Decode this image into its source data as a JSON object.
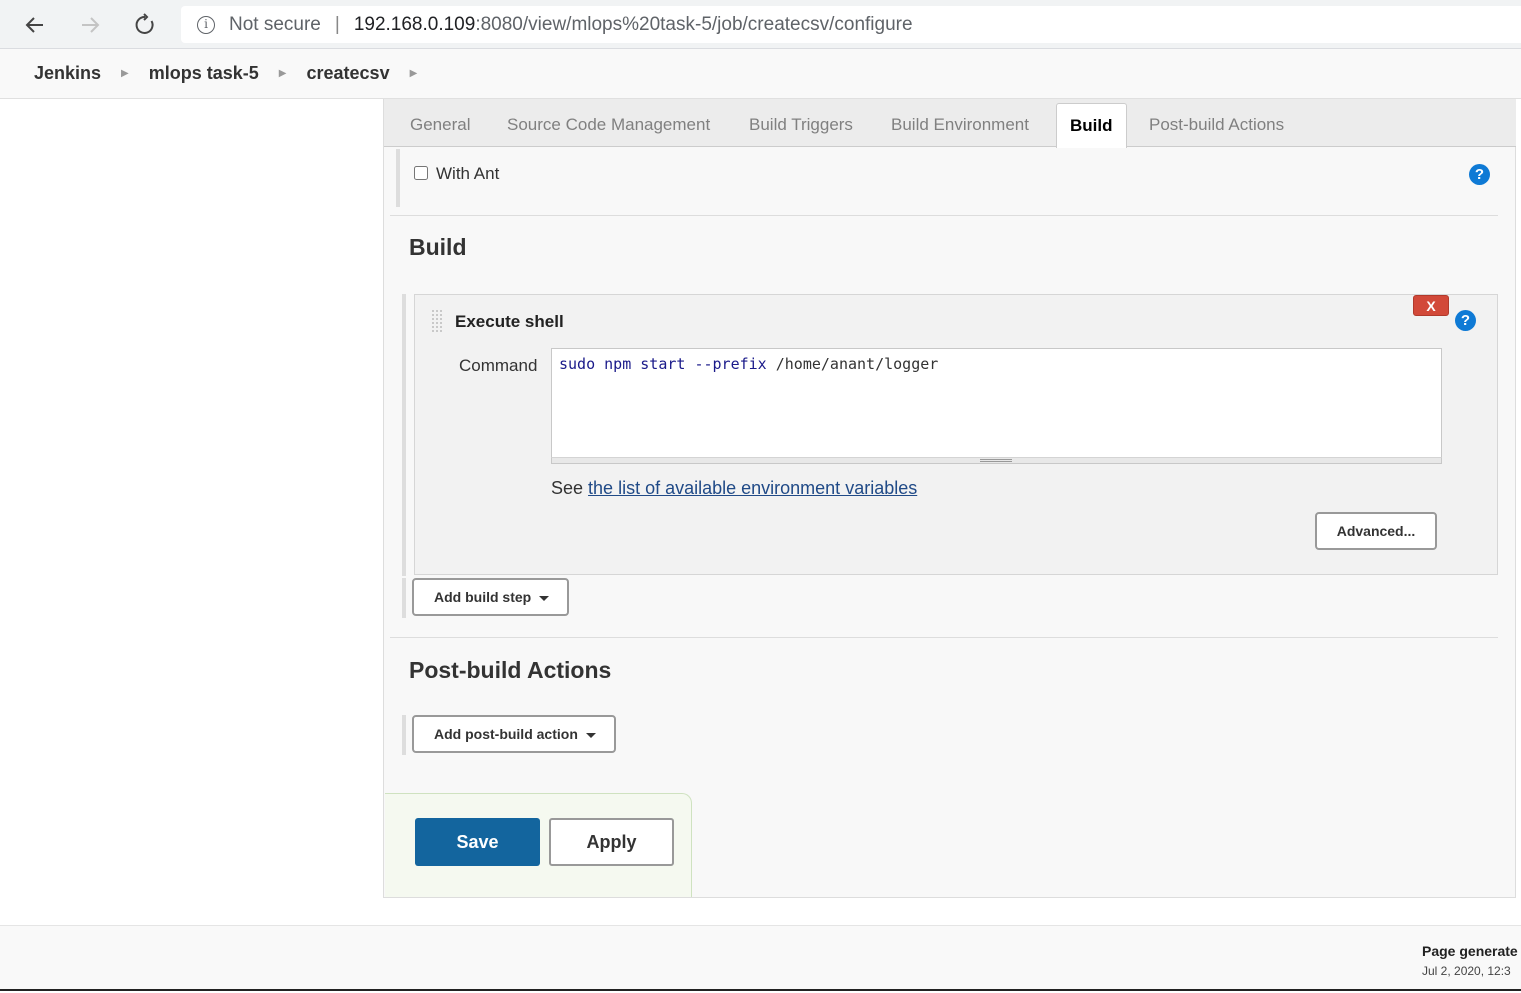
{
  "browser": {
    "security_label": "Not secure",
    "separator": "|",
    "url_host": "192.168.0.109",
    "url_rest": ":8080/view/mlops%20task-5/job/createcsv/configure"
  },
  "breadcrumbs": [
    "Jenkins",
    "mlops task-5",
    "createcsv"
  ],
  "tabs": [
    "General",
    "Source Code Management",
    "Build Triggers",
    "Build Environment",
    "Build",
    "Post-build Actions"
  ],
  "active_tab": "Build",
  "with_ant": {
    "label": "With Ant",
    "checked": false
  },
  "build_section": {
    "title": "Build",
    "step": {
      "title": "Execute shell",
      "delete_label": "X",
      "command_label": "Command",
      "command_keywords": "sudo npm start --prefix",
      "command_path": "/home/anant/logger",
      "env_prefix": "See",
      "env_link": "the list of available environment variables",
      "advanced_label": "Advanced..."
    },
    "add_step_label": "Add build step"
  },
  "post_build": {
    "title": "Post-build Actions",
    "add_action_label": "Add post-build action"
  },
  "buttons": {
    "save": "Save",
    "apply": "Apply"
  },
  "help_glyph": "?",
  "footer": {
    "generated": "Page generate",
    "date": "Jul 2, 2020, 12:3"
  }
}
